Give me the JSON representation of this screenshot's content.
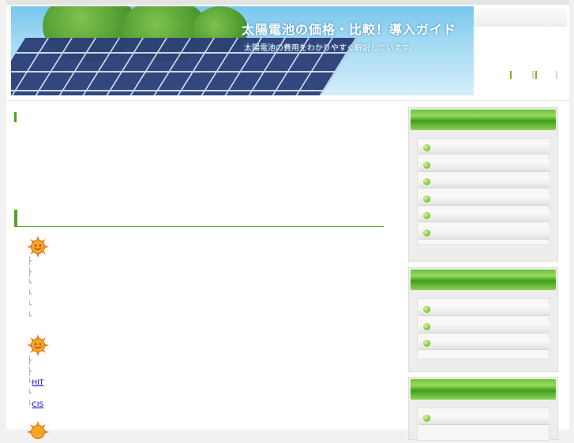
{
  "site": {
    "title": "太陽電池の価格・比較！導入ガイド",
    "subtitle": "太陽電池の費用をわかりやすく解説しています。"
  },
  "colors": {
    "accent": "#4fa520",
    "link": "#0000cc",
    "sidebar_header": "#5cb82e"
  },
  "main": {
    "section1_heading": "",
    "section2_heading": "",
    "group1": {
      "icon": "sun-face-icon",
      "items": [
        {
          "connector": "├",
          "label": ""
        },
        {
          "connector": "├",
          "label": ""
        },
        {
          "connector": "└",
          "label": ""
        },
        {
          "connector": "└",
          "label": ""
        },
        {
          "connector": "└",
          "label": ""
        },
        {
          "connector": "└",
          "label": ""
        }
      ]
    },
    "group2": {
      "icon": "sun-face-icon",
      "items": [
        {
          "connector": "├",
          "label": ""
        },
        {
          "connector": "├",
          "label": ""
        },
        {
          "connector": "└",
          "label": "HIT"
        },
        {
          "connector": "└",
          "label": ""
        },
        {
          "connector": "└",
          "label": "CIS"
        }
      ]
    }
  },
  "sidebar": {
    "box1": {
      "header": "",
      "items": [
        "",
        "",
        "",
        "",
        "",
        ""
      ]
    },
    "box2": {
      "header": "",
      "items": [
        "",
        "",
        ""
      ]
    },
    "box3": {
      "header": "",
      "items": [
        ""
      ]
    }
  }
}
